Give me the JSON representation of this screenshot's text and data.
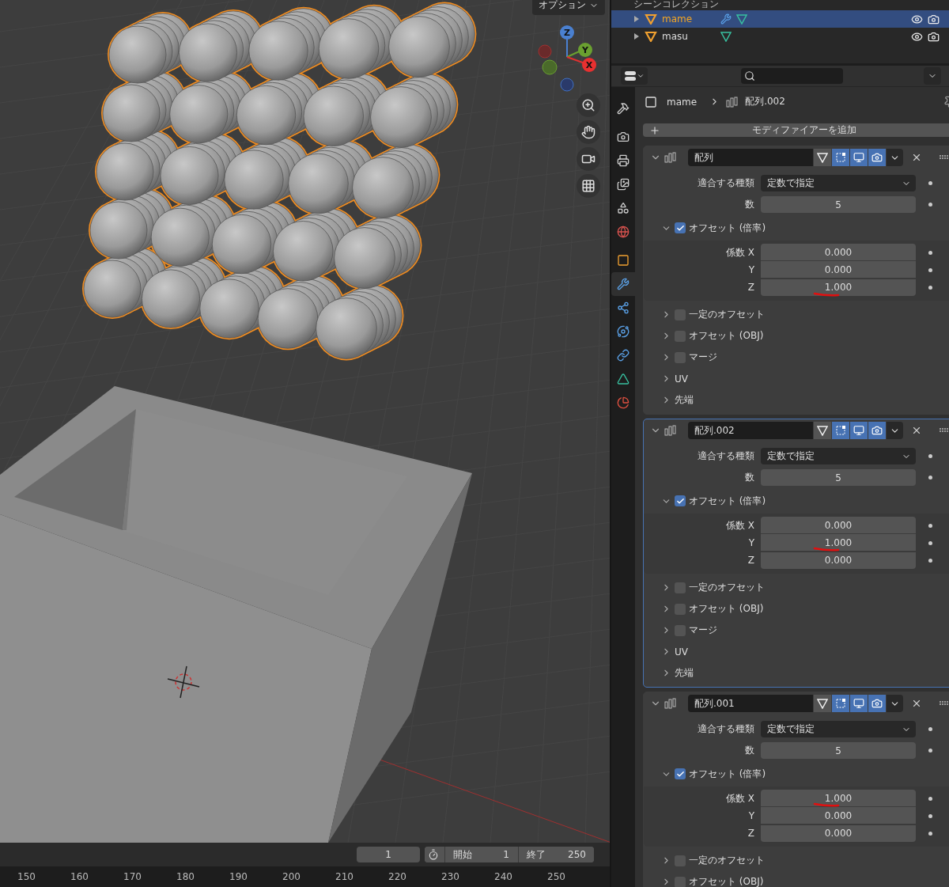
{
  "viewport": {
    "options_button": "オプション",
    "axes": [
      {
        "label": "Z"
      },
      {
        "label": "Y"
      },
      {
        "label": "X"
      }
    ]
  },
  "timeline": {
    "current_frame": "1",
    "start_label": "開始",
    "start": "1",
    "end_label": "終了",
    "end": "250",
    "ruler": [
      "150",
      "160",
      "170",
      "180",
      "190",
      "200",
      "210",
      "220",
      "230",
      "240",
      "250"
    ]
  },
  "outliner": {
    "collection": "シーンコレクション",
    "items": [
      {
        "name": "mame",
        "selected": true,
        "has_modifier": true
      },
      {
        "name": "masu",
        "selected": false,
        "has_modifier": false
      }
    ]
  },
  "properties": {
    "tabs": [
      {
        "kind": "tool",
        "selected": false
      },
      {
        "kind": "render",
        "selected": false
      },
      {
        "kind": "output",
        "selected": false
      },
      {
        "kind": "view_layer",
        "selected": false
      },
      {
        "kind": "scene",
        "selected": false
      },
      {
        "kind": "world",
        "selected": false
      },
      {
        "kind": "object",
        "selected": false
      },
      {
        "kind": "modifier",
        "selected": true
      },
      {
        "kind": "particles",
        "selected": false
      },
      {
        "kind": "physics",
        "selected": false
      },
      {
        "kind": "constraints",
        "selected": false
      },
      {
        "kind": "data",
        "selected": false
      },
      {
        "kind": "material",
        "selected": false
      }
    ],
    "breadcrumb": {
      "object": "mame",
      "modifier": "配列.002"
    },
    "add_button": "モディファイアーを追加",
    "modifiers": [
      {
        "name": "配列",
        "active": false,
        "expanded": true,
        "toggles": [
          {
            "kind": "cage",
            "on": false
          },
          {
            "kind": "editmode",
            "on": true
          },
          {
            "kind": "viewport",
            "on": true
          },
          {
            "kind": "render",
            "on": true
          }
        ],
        "fit_type_label": "適合する種類",
        "fit_type": "定数で指定",
        "count_label": "数",
        "count": "5",
        "offset": {
          "label": "オフセット (倍率)",
          "checked": true,
          "expanded": true,
          "factors": [
            {
              "label": "係数 X",
              "value": "0.000",
              "underlined": false
            },
            {
              "label": "Y",
              "value": "0.000",
              "underlined": false
            },
            {
              "label": "Z",
              "value": "1.000",
              "underlined": true
            }
          ]
        },
        "subpanels": [
          {
            "kind": "checkbox",
            "label": "一定のオフセット",
            "checked": false
          },
          {
            "kind": "checkbox",
            "label": "オフセット (OBJ)",
            "checked": false
          },
          {
            "kind": "checkbox",
            "label": "マージ",
            "checked": false
          },
          {
            "kind": "plain",
            "label": "UV"
          },
          {
            "kind": "plain",
            "label": "先端"
          }
        ]
      },
      {
        "name": "配列.002",
        "active": true,
        "expanded": true,
        "toggles": [
          {
            "kind": "cage",
            "on": false
          },
          {
            "kind": "editmode",
            "on": true
          },
          {
            "kind": "viewport",
            "on": true
          },
          {
            "kind": "render",
            "on": true
          }
        ],
        "fit_type_label": "適合する種類",
        "fit_type": "定数で指定",
        "count_label": "数",
        "count": "5",
        "offset": {
          "label": "オフセット (倍率)",
          "checked": true,
          "expanded": true,
          "factors": [
            {
              "label": "係数 X",
              "value": "0.000",
              "underlined": false
            },
            {
              "label": "Y",
              "value": "1.000",
              "underlined": true
            },
            {
              "label": "Z",
              "value": "0.000",
              "underlined": false
            }
          ]
        },
        "subpanels": [
          {
            "kind": "checkbox",
            "label": "一定のオフセット",
            "checked": false
          },
          {
            "kind": "checkbox",
            "label": "オフセット (OBJ)",
            "checked": false
          },
          {
            "kind": "checkbox",
            "label": "マージ",
            "checked": false
          },
          {
            "kind": "plain",
            "label": "UV"
          },
          {
            "kind": "plain",
            "label": "先端"
          }
        ]
      },
      {
        "name": "配列.001",
        "active": false,
        "expanded": true,
        "toggles": [
          {
            "kind": "cage",
            "on": false
          },
          {
            "kind": "editmode",
            "on": true
          },
          {
            "kind": "viewport",
            "on": true
          },
          {
            "kind": "render",
            "on": true
          }
        ],
        "fit_type_label": "適合する種類",
        "fit_type": "定数で指定",
        "count_label": "数",
        "count": "5",
        "offset": {
          "label": "オフセット (倍率)",
          "checked": true,
          "expanded": true,
          "factors": [
            {
              "label": "係数 X",
              "value": "1.000",
              "underlined": true
            },
            {
              "label": "Y",
              "value": "0.000",
              "underlined": false
            },
            {
              "label": "Z",
              "value": "0.000",
              "underlined": false
            }
          ]
        },
        "subpanels": [
          {
            "kind": "checkbox",
            "label": "一定のオフセット",
            "checked": false
          },
          {
            "kind": "checkbox",
            "label": "オフセット (OBJ)",
            "checked": false
          }
        ]
      }
    ]
  }
}
